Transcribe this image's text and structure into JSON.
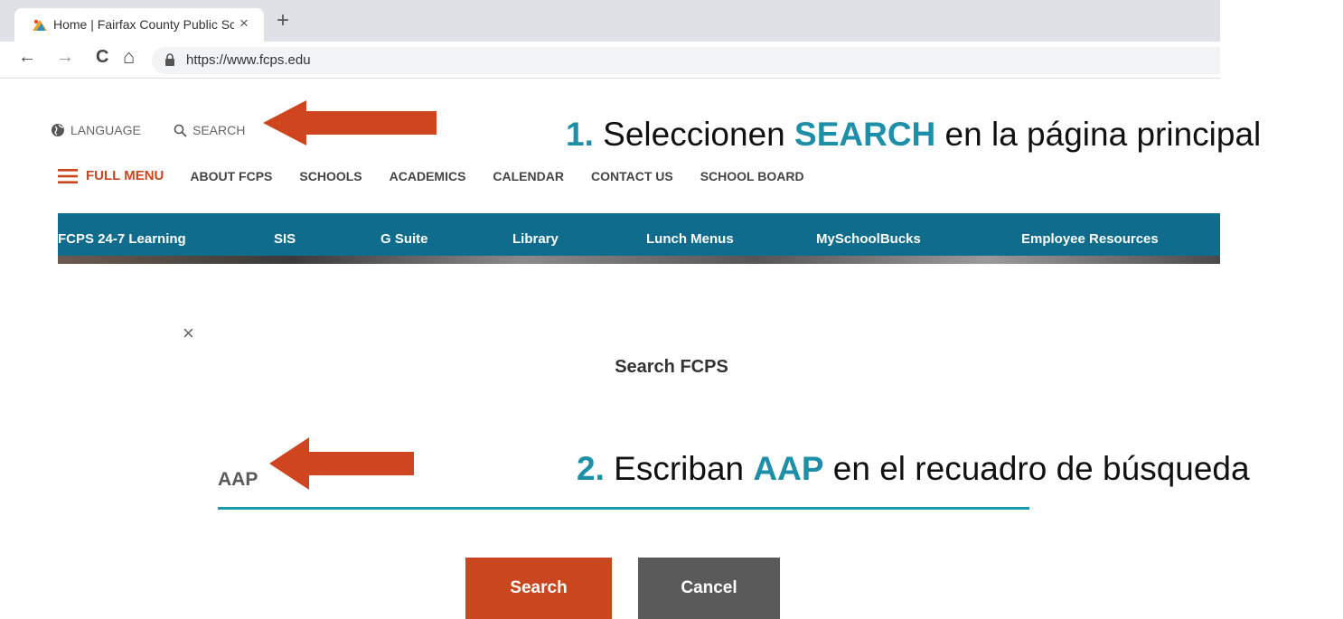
{
  "browser": {
    "tab_title": "Home | Fairfax County Public Sch",
    "tab_close": "×",
    "new_tab": "+",
    "back": "←",
    "forward": "→",
    "reload": "C",
    "home": "⌂",
    "url": "https://www.fcps.edu"
  },
  "header": {
    "language_label": "LANGUAGE",
    "search_label": "SEARCH",
    "full_menu": "FULL MENU",
    "nav": [
      "ABOUT FCPS",
      "SCHOOLS",
      "ACADEMICS",
      "CALENDAR",
      "CONTACT US",
      "SCHOOL BOARD"
    ]
  },
  "quicklinks": [
    "FCPS 24-7 Learning",
    "SIS",
    "G Suite",
    "Library",
    "Lunch Menus",
    "MySchoolBucks",
    "Employee Resources"
  ],
  "annotations": {
    "step1": {
      "number": "1.",
      "before": "Seleccionen",
      "keyword": "SEARCH",
      "after": "en la página principal"
    },
    "step2": {
      "number": "2.",
      "before": "Escriban",
      "keyword": "AAP",
      "after": "en el recuadro de búsqueda"
    }
  },
  "modal": {
    "close": "×",
    "title": "Search FCPS",
    "input_value": "AAP",
    "search_button": "Search",
    "cancel_button": "Cancel"
  },
  "colors": {
    "accent_orange": "#c9461f",
    "nav_blue": "#0f6c8c",
    "annotation_teal": "#1e8fa8",
    "arrow": "#cf4520"
  }
}
